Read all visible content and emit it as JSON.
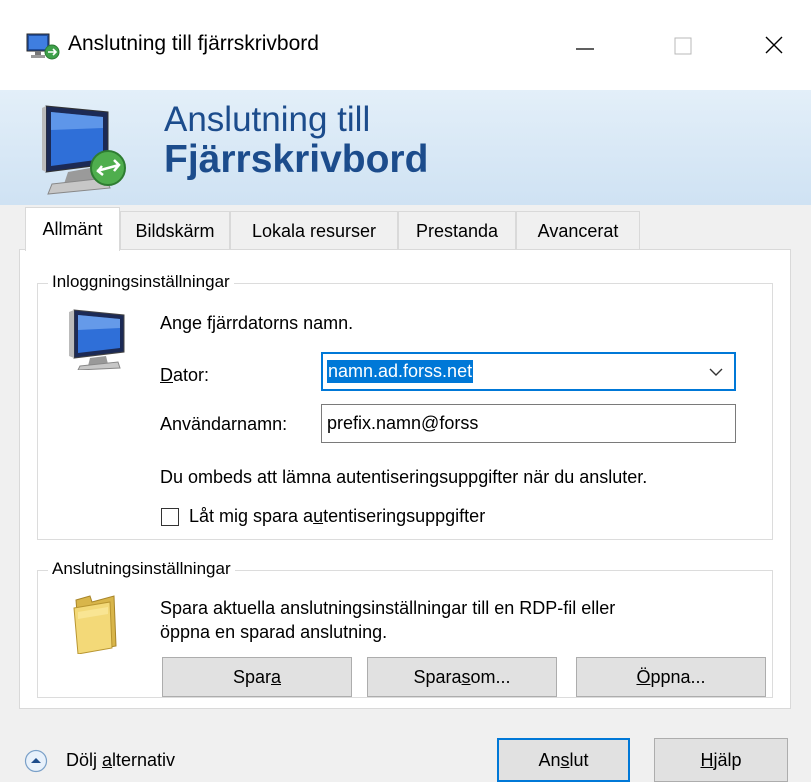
{
  "window": {
    "title": "Anslutning till fjärrskrivbord"
  },
  "banner": {
    "line1": "Anslutning till",
    "line2": "Fjärrskrivbord"
  },
  "tabs": [
    {
      "label": "Allmänt",
      "active": true
    },
    {
      "label": "Bildskärm"
    },
    {
      "label": "Lokala resurser"
    },
    {
      "label": "Prestanda"
    },
    {
      "label": "Avancerat"
    }
  ],
  "login": {
    "legend": "Inloggningsinställningar",
    "prompt": "Ange fjärrdatorns namn.",
    "computer_label": "Dator:",
    "computer_value": "namn.ad.forss.net",
    "username_label": "Användarnamn:",
    "username_value": "prefix.namn@forss",
    "info": "Du ombeds att lämna autentiseringsuppgifter när du ansluter.",
    "save_creds_pre": "Låt mig spara a",
    "save_creds_key": "u",
    "save_creds_post": "tentiseringsuppgifter",
    "save_creds_checked": false
  },
  "connection": {
    "legend": "Anslutningsinställningar",
    "desc_line1": "Spara aktuella anslutningsinställningar till en RDP-fil eller",
    "desc_line2": "öppna en sparad anslutning.",
    "save_pre": "Spar",
    "save_key": "a",
    "save_post": "",
    "saveas_pre": "Spara ",
    "saveas_key": "s",
    "saveas_post": "om...",
    "open_pre": "",
    "open_key": "Ö",
    "open_post": "ppna..."
  },
  "footer": {
    "hide_pre": "Dölj ",
    "hide_key": "a",
    "hide_post": "lternativ",
    "connect_pre": "An",
    "connect_key": "s",
    "connect_post": "lut",
    "help_pre": "",
    "help_key": "H",
    "help_post": "jälp"
  },
  "colors": {
    "accent": "#0078d7",
    "banner_text": "#1c4c8c"
  }
}
